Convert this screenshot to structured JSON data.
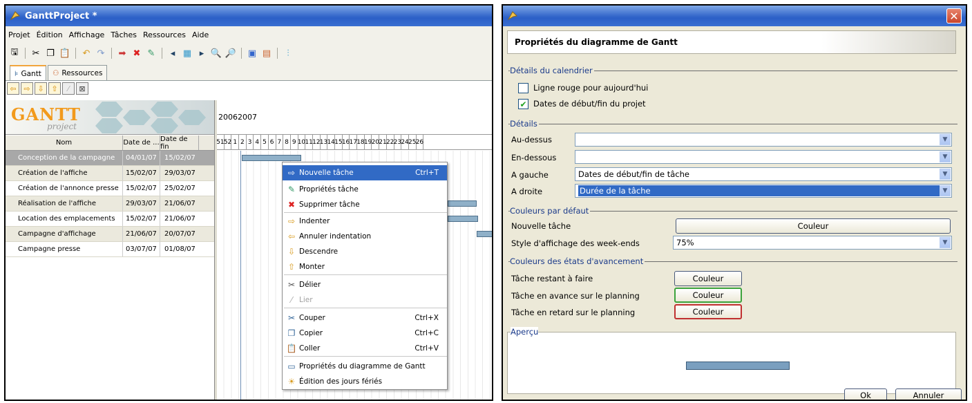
{
  "left_window": {
    "title": "GanttProject *",
    "menu": [
      "Projet",
      "Édition",
      "Affichage",
      "Tâches",
      "Ressources",
      "Aide"
    ],
    "tabs": [
      {
        "label": "Gantt",
        "active": true
      },
      {
        "label": "Ressources",
        "active": false
      }
    ],
    "logo": {
      "main": "GANTT",
      "sub": "project"
    },
    "table": {
      "headers": {
        "name": "Nom",
        "start": "Date de ...",
        "end": "Date de fin"
      },
      "rows": [
        {
          "name": "Conception de la campagne",
          "start": "04/01/07",
          "end": "15/02/07",
          "selected": true
        },
        {
          "name": "Création de l'affiche",
          "start": "15/02/07",
          "end": "29/03/07"
        },
        {
          "name": "Création de l'annonce presse",
          "start": "15/02/07",
          "end": "25/02/07"
        },
        {
          "name": "Réalisation de l'affiche",
          "start": "29/03/07",
          "end": "21/06/07"
        },
        {
          "name": "Location des emplacements",
          "start": "15/02/07",
          "end": "21/06/07"
        },
        {
          "name": "Campagne d'affichage",
          "start": "21/06/07",
          "end": "20/07/07"
        },
        {
          "name": "Campagne presse",
          "start": "03/07/07",
          "end": "01/08/07"
        }
      ]
    },
    "chart": {
      "years": [
        "2006",
        "2007"
      ],
      "weeks": [
        "51",
        "52",
        "1",
        "2",
        "3",
        "4",
        "5",
        "6",
        "7",
        "8",
        "9",
        "10",
        "11",
        "12",
        "13",
        "14",
        "15",
        "16",
        "17",
        "18",
        "19",
        "20",
        "21",
        "22",
        "23",
        "24",
        "25",
        "26"
      ]
    },
    "context_menu": {
      "items": [
        {
          "label": "Nouvelle tâche",
          "shortcut": "Ctrl+T",
          "icon": "new-task-icon",
          "highlighted": true
        },
        {
          "label": "Propriétés tâche",
          "shortcut": "",
          "icon": "task-properties-icon"
        },
        {
          "label": "Supprimer tâche",
          "shortcut": "",
          "icon": "delete-icon"
        },
        {
          "label": "Indenter",
          "shortcut": "",
          "icon": "indent-icon"
        },
        {
          "label": "Annuler indentation",
          "shortcut": "",
          "icon": "unindent-icon"
        },
        {
          "label": "Descendre",
          "shortcut": "",
          "icon": "move-down-icon"
        },
        {
          "label": "Monter",
          "shortcut": "",
          "icon": "move-up-icon"
        },
        {
          "label": "Délier",
          "shortcut": "",
          "icon": "unlink-icon"
        },
        {
          "label": "Lier",
          "shortcut": "",
          "icon": "link-icon",
          "disabled": true
        },
        {
          "label": "Couper",
          "shortcut": "Ctrl+X",
          "icon": "cut-icon"
        },
        {
          "label": "Copier",
          "shortcut": "Ctrl+C",
          "icon": "copy-icon"
        },
        {
          "label": "Coller",
          "shortcut": "Ctrl+V",
          "icon": "paste-icon"
        },
        {
          "label": "Propriétés du diagramme de Gantt",
          "shortcut": "",
          "icon": "chart-properties-icon"
        },
        {
          "label": "Édition des jours fériés",
          "shortcut": "",
          "icon": "holidays-icon"
        }
      ]
    }
  },
  "dialog": {
    "header": "Propriétés du diagramme de Gantt",
    "sections": {
      "calendar": "Détails du calendrier",
      "details": "Détails",
      "colors": "Couleurs par défaut",
      "progress": "Couleurs des états d'avancement",
      "preview": "Aperçu"
    },
    "calendar": {
      "red_line": {
        "label": "Ligne rouge pour aujourd'hui",
        "checked": false
      },
      "project_dates": {
        "label": "Dates de début/fin du projet",
        "checked": true
      }
    },
    "details": {
      "above": {
        "label": "Au-dessus",
        "value": ""
      },
      "below": {
        "label": "En-dessous",
        "value": ""
      },
      "left": {
        "label": "A gauche",
        "value": "Dates de début/fin de tâche"
      },
      "right": {
        "label": "A droite",
        "value": "Durée de la tâche"
      }
    },
    "colors": {
      "new_task_label": "Nouvelle tâche",
      "color_button": "Couleur",
      "weekend_label": "Style d'affichage des week-ends",
      "weekend_value": "75%"
    },
    "progress": {
      "todo": "Tâche restant à faire",
      "ahead": "Tâche en avance sur le planning",
      "late": "Tâche en retard sur le planning",
      "button": "Couleur"
    },
    "buttons": {
      "ok": "Ok",
      "cancel": "Annuler",
      "close": "✕"
    }
  }
}
